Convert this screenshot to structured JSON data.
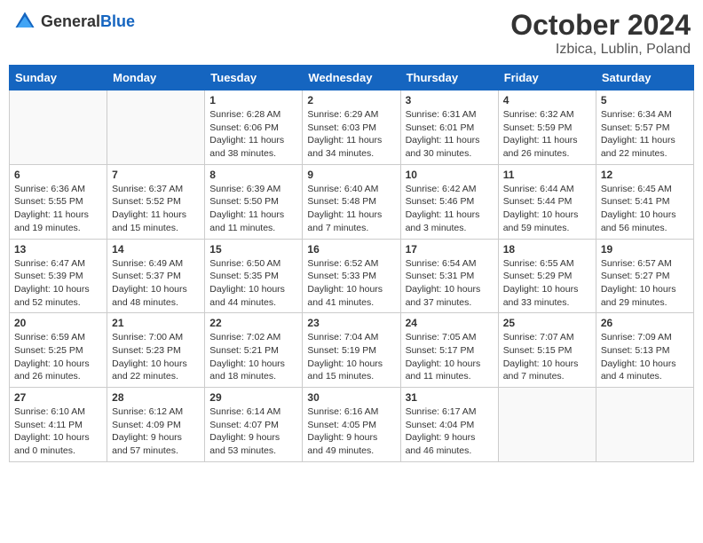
{
  "header": {
    "logo_general": "General",
    "logo_blue": "Blue",
    "title": "October 2024",
    "location": "Izbica, Lublin, Poland"
  },
  "weekdays": [
    "Sunday",
    "Monday",
    "Tuesday",
    "Wednesday",
    "Thursday",
    "Friday",
    "Saturday"
  ],
  "weeks": [
    [
      {
        "day": "",
        "sunrise": "",
        "sunset": "",
        "daylight": ""
      },
      {
        "day": "",
        "sunrise": "",
        "sunset": "",
        "daylight": ""
      },
      {
        "day": "1",
        "sunrise": "Sunrise: 6:28 AM",
        "sunset": "Sunset: 6:06 PM",
        "daylight": "Daylight: 11 hours and 38 minutes."
      },
      {
        "day": "2",
        "sunrise": "Sunrise: 6:29 AM",
        "sunset": "Sunset: 6:03 PM",
        "daylight": "Daylight: 11 hours and 34 minutes."
      },
      {
        "day": "3",
        "sunrise": "Sunrise: 6:31 AM",
        "sunset": "Sunset: 6:01 PM",
        "daylight": "Daylight: 11 hours and 30 minutes."
      },
      {
        "day": "4",
        "sunrise": "Sunrise: 6:32 AM",
        "sunset": "Sunset: 5:59 PM",
        "daylight": "Daylight: 11 hours and 26 minutes."
      },
      {
        "day": "5",
        "sunrise": "Sunrise: 6:34 AM",
        "sunset": "Sunset: 5:57 PM",
        "daylight": "Daylight: 11 hours and 22 minutes."
      }
    ],
    [
      {
        "day": "6",
        "sunrise": "Sunrise: 6:36 AM",
        "sunset": "Sunset: 5:55 PM",
        "daylight": "Daylight: 11 hours and 19 minutes."
      },
      {
        "day": "7",
        "sunrise": "Sunrise: 6:37 AM",
        "sunset": "Sunset: 5:52 PM",
        "daylight": "Daylight: 11 hours and 15 minutes."
      },
      {
        "day": "8",
        "sunrise": "Sunrise: 6:39 AM",
        "sunset": "Sunset: 5:50 PM",
        "daylight": "Daylight: 11 hours and 11 minutes."
      },
      {
        "day": "9",
        "sunrise": "Sunrise: 6:40 AM",
        "sunset": "Sunset: 5:48 PM",
        "daylight": "Daylight: 11 hours and 7 minutes."
      },
      {
        "day": "10",
        "sunrise": "Sunrise: 6:42 AM",
        "sunset": "Sunset: 5:46 PM",
        "daylight": "Daylight: 11 hours and 3 minutes."
      },
      {
        "day": "11",
        "sunrise": "Sunrise: 6:44 AM",
        "sunset": "Sunset: 5:44 PM",
        "daylight": "Daylight: 10 hours and 59 minutes."
      },
      {
        "day": "12",
        "sunrise": "Sunrise: 6:45 AM",
        "sunset": "Sunset: 5:41 PM",
        "daylight": "Daylight: 10 hours and 56 minutes."
      }
    ],
    [
      {
        "day": "13",
        "sunrise": "Sunrise: 6:47 AM",
        "sunset": "Sunset: 5:39 PM",
        "daylight": "Daylight: 10 hours and 52 minutes."
      },
      {
        "day": "14",
        "sunrise": "Sunrise: 6:49 AM",
        "sunset": "Sunset: 5:37 PM",
        "daylight": "Daylight: 10 hours and 48 minutes."
      },
      {
        "day": "15",
        "sunrise": "Sunrise: 6:50 AM",
        "sunset": "Sunset: 5:35 PM",
        "daylight": "Daylight: 10 hours and 44 minutes."
      },
      {
        "day": "16",
        "sunrise": "Sunrise: 6:52 AM",
        "sunset": "Sunset: 5:33 PM",
        "daylight": "Daylight: 10 hours and 41 minutes."
      },
      {
        "day": "17",
        "sunrise": "Sunrise: 6:54 AM",
        "sunset": "Sunset: 5:31 PM",
        "daylight": "Daylight: 10 hours and 37 minutes."
      },
      {
        "day": "18",
        "sunrise": "Sunrise: 6:55 AM",
        "sunset": "Sunset: 5:29 PM",
        "daylight": "Daylight: 10 hours and 33 minutes."
      },
      {
        "day": "19",
        "sunrise": "Sunrise: 6:57 AM",
        "sunset": "Sunset: 5:27 PM",
        "daylight": "Daylight: 10 hours and 29 minutes."
      }
    ],
    [
      {
        "day": "20",
        "sunrise": "Sunrise: 6:59 AM",
        "sunset": "Sunset: 5:25 PM",
        "daylight": "Daylight: 10 hours and 26 minutes."
      },
      {
        "day": "21",
        "sunrise": "Sunrise: 7:00 AM",
        "sunset": "Sunset: 5:23 PM",
        "daylight": "Daylight: 10 hours and 22 minutes."
      },
      {
        "day": "22",
        "sunrise": "Sunrise: 7:02 AM",
        "sunset": "Sunset: 5:21 PM",
        "daylight": "Daylight: 10 hours and 18 minutes."
      },
      {
        "day": "23",
        "sunrise": "Sunrise: 7:04 AM",
        "sunset": "Sunset: 5:19 PM",
        "daylight": "Daylight: 10 hours and 15 minutes."
      },
      {
        "day": "24",
        "sunrise": "Sunrise: 7:05 AM",
        "sunset": "Sunset: 5:17 PM",
        "daylight": "Daylight: 10 hours and 11 minutes."
      },
      {
        "day": "25",
        "sunrise": "Sunrise: 7:07 AM",
        "sunset": "Sunset: 5:15 PM",
        "daylight": "Daylight: 10 hours and 7 minutes."
      },
      {
        "day": "26",
        "sunrise": "Sunrise: 7:09 AM",
        "sunset": "Sunset: 5:13 PM",
        "daylight": "Daylight: 10 hours and 4 minutes."
      }
    ],
    [
      {
        "day": "27",
        "sunrise": "Sunrise: 6:10 AM",
        "sunset": "Sunset: 4:11 PM",
        "daylight": "Daylight: 10 hours and 0 minutes."
      },
      {
        "day": "28",
        "sunrise": "Sunrise: 6:12 AM",
        "sunset": "Sunset: 4:09 PM",
        "daylight": "Daylight: 9 hours and 57 minutes."
      },
      {
        "day": "29",
        "sunrise": "Sunrise: 6:14 AM",
        "sunset": "Sunset: 4:07 PM",
        "daylight": "Daylight: 9 hours and 53 minutes."
      },
      {
        "day": "30",
        "sunrise": "Sunrise: 6:16 AM",
        "sunset": "Sunset: 4:05 PM",
        "daylight": "Daylight: 9 hours and 49 minutes."
      },
      {
        "day": "31",
        "sunrise": "Sunrise: 6:17 AM",
        "sunset": "Sunset: 4:04 PM",
        "daylight": "Daylight: 9 hours and 46 minutes."
      },
      {
        "day": "",
        "sunrise": "",
        "sunset": "",
        "daylight": ""
      },
      {
        "day": "",
        "sunrise": "",
        "sunset": "",
        "daylight": ""
      }
    ]
  ]
}
